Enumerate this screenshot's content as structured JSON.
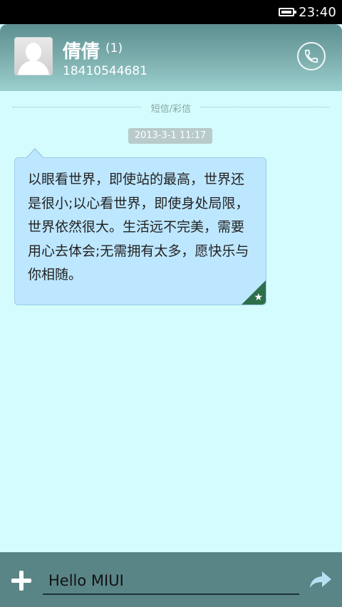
{
  "status_bar": {
    "time": "23:40",
    "battery_icon": "battery-full-icon"
  },
  "header": {
    "contact_name": "倩倩",
    "unread_count": "(1)",
    "phone_number": "18410544681",
    "call_icon": "phone-icon"
  },
  "conversation": {
    "divider_label": "短信/彩信",
    "timestamp": "2013-3-1 11:17",
    "message_text": "以眼看世界，即使站的最高，世界还是很小;以心看世界，即使身处局限，世界依然很大。生活远不完美，需要用心去体会;无需拥有太多，愿快乐与你相随。",
    "favorite_icon": "star-icon"
  },
  "composer": {
    "input_value": "Hello MIUI",
    "add_icon": "plus-icon",
    "send_icon": "send-arrow-icon"
  },
  "colors": {
    "background": "#d4fcfd",
    "header": "#7fb0b0",
    "bubble": "#bde7ff",
    "composer": "#5a8587",
    "star_corner": "#2d6f4b"
  }
}
